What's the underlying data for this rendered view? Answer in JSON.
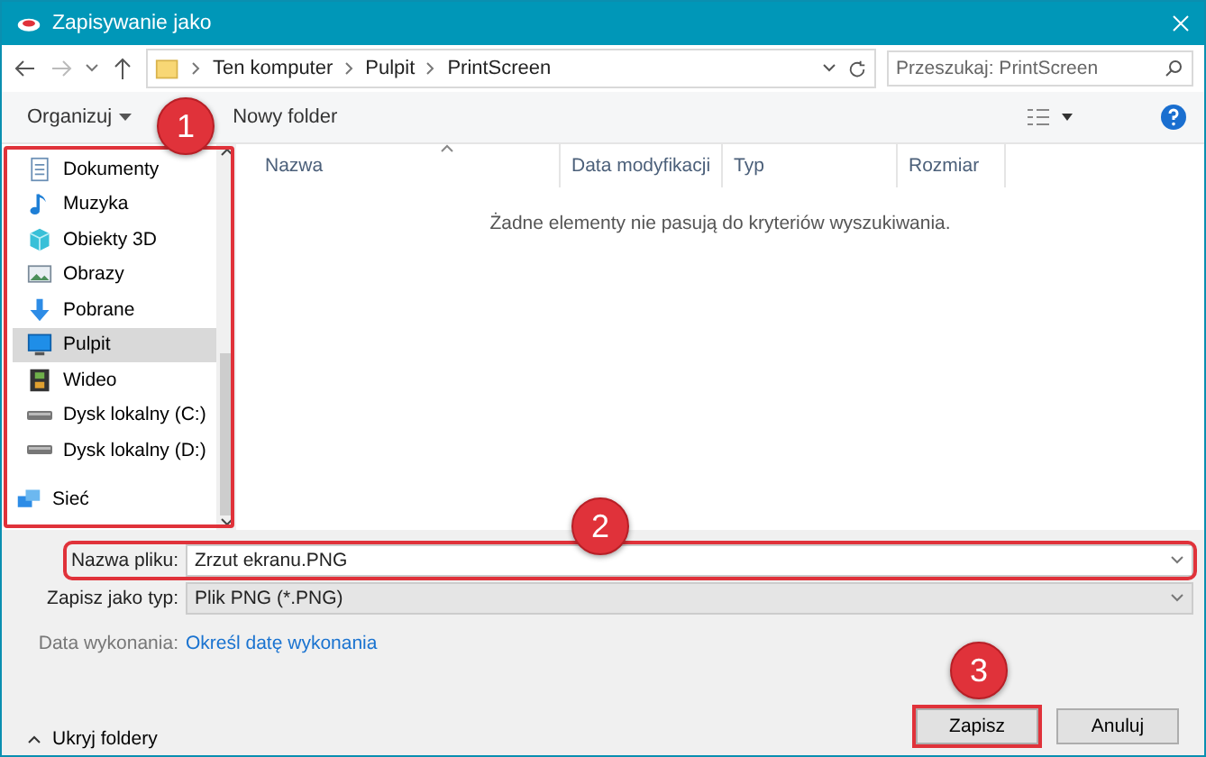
{
  "window": {
    "title": "Zapisywanie jako"
  },
  "address_bar": {
    "path": [
      {
        "label": "Ten komputer"
      },
      {
        "label": "Pulpit"
      },
      {
        "label": "PrintScreen"
      }
    ]
  },
  "search": {
    "placeholder": "Przeszukaj: PrintScreen"
  },
  "toolbar": {
    "organize": "Organizuj",
    "new_folder": "Nowy folder"
  },
  "sidebar": {
    "highlighted": true,
    "badge": "1",
    "items": [
      {
        "label": "Dokumenty",
        "kind": "documents",
        "selected": false
      },
      {
        "label": "Muzyka",
        "kind": "music",
        "selected": false
      },
      {
        "label": "Obiekty 3D",
        "kind": "cube",
        "selected": false
      },
      {
        "label": "Obrazy",
        "kind": "pictures",
        "selected": false
      },
      {
        "label": "Pobrane",
        "kind": "download",
        "selected": false
      },
      {
        "label": "Pulpit",
        "kind": "desktop",
        "selected": true
      },
      {
        "label": "Wideo",
        "kind": "video",
        "selected": false
      },
      {
        "label": "Dysk lokalny (C:)",
        "kind": "drive",
        "selected": false
      },
      {
        "label": "Dysk lokalny (D:)",
        "kind": "drive",
        "selected": false
      },
      {
        "label": "Sieć",
        "kind": "network",
        "selected": false
      }
    ]
  },
  "file_list": {
    "columns": [
      "Nazwa",
      "Data modyfikacji",
      "Typ",
      "Rozmiar"
    ],
    "empty_message": "Żadne elementy nie pasują do kryteriów wyszukiwania."
  },
  "filename": {
    "label": "Nazwa pliku:",
    "value": "Zrzut ekranu.PNG",
    "highlighted": true,
    "badge": "2"
  },
  "file_type": {
    "label": "Zapisz jako typ:",
    "value": "Plik PNG (*.PNG)"
  },
  "date_taken": {
    "label": "Data wykonania:",
    "link": "Określ datę wykonania"
  },
  "hide_folders": "Ukryj foldery",
  "buttons": [
    {
      "label": "Zapisz",
      "highlighted": true,
      "badge": "3"
    },
    {
      "label": "Anuluj",
      "highlighted": false
    }
  ]
}
